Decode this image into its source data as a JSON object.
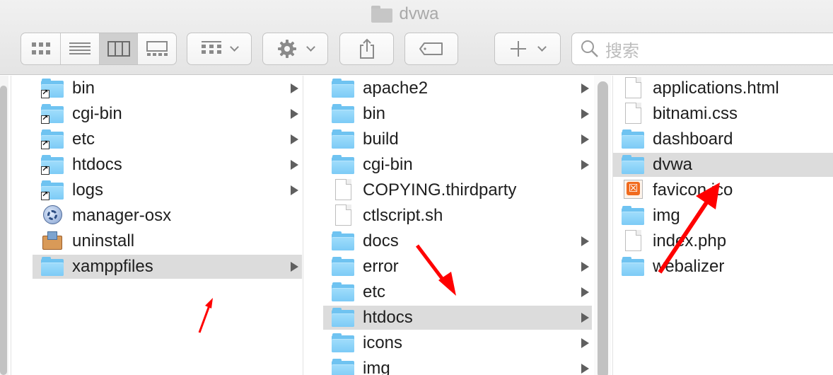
{
  "window": {
    "title": "dvwa"
  },
  "toolbar": {
    "search_placeholder": "搜索"
  },
  "columns": [
    {
      "items": [
        {
          "label": "bin",
          "icon": "folder-alias-icon",
          "has_children": true,
          "selected": false
        },
        {
          "label": "cgi-bin",
          "icon": "folder-alias-icon",
          "has_children": true,
          "selected": false
        },
        {
          "label": "etc",
          "icon": "folder-alias-icon",
          "has_children": true,
          "selected": false
        },
        {
          "label": "htdocs",
          "icon": "folder-alias-icon",
          "has_children": true,
          "selected": false
        },
        {
          "label": "logs",
          "icon": "folder-alias-icon",
          "has_children": true,
          "selected": false
        },
        {
          "label": "manager-osx",
          "icon": "manager-app-icon",
          "has_children": false,
          "selected": false
        },
        {
          "label": "uninstall",
          "icon": "uninstall-app-icon",
          "has_children": false,
          "selected": false
        },
        {
          "label": "xamppfiles",
          "icon": "folder-icon",
          "has_children": true,
          "selected": true
        }
      ]
    },
    {
      "items": [
        {
          "label": "apache2",
          "icon": "folder-icon",
          "has_children": true,
          "selected": false
        },
        {
          "label": "bin",
          "icon": "folder-icon",
          "has_children": true,
          "selected": false
        },
        {
          "label": "build",
          "icon": "folder-icon",
          "has_children": true,
          "selected": false
        },
        {
          "label": "cgi-bin",
          "icon": "folder-icon",
          "has_children": true,
          "selected": false
        },
        {
          "label": "COPYING.thirdparty",
          "icon": "document-icon",
          "has_children": false,
          "selected": false
        },
        {
          "label": "ctlscript.sh",
          "icon": "document-icon",
          "has_children": false,
          "selected": false
        },
        {
          "label": "docs",
          "icon": "folder-icon",
          "has_children": true,
          "selected": false
        },
        {
          "label": "error",
          "icon": "folder-icon",
          "has_children": true,
          "selected": false
        },
        {
          "label": "etc",
          "icon": "folder-icon",
          "has_children": true,
          "selected": false
        },
        {
          "label": "htdocs",
          "icon": "folder-icon",
          "has_children": true,
          "selected": true
        },
        {
          "label": "icons",
          "icon": "folder-icon",
          "has_children": true,
          "selected": false
        },
        {
          "label": "img",
          "icon": "folder-icon",
          "has_children": true,
          "selected": false
        }
      ]
    },
    {
      "items": [
        {
          "label": "applications.html",
          "icon": "document-icon",
          "has_children": false,
          "selected": false
        },
        {
          "label": "bitnami.css",
          "icon": "document-icon",
          "has_children": false,
          "selected": false
        },
        {
          "label": "dashboard",
          "icon": "folder-icon",
          "has_children": false,
          "selected": false
        },
        {
          "label": "dvwa",
          "icon": "folder-icon",
          "has_children": false,
          "selected": true
        },
        {
          "label": "favicon.ico",
          "icon": "xampp-favicon-icon",
          "has_children": false,
          "selected": false
        },
        {
          "label": "img",
          "icon": "folder-icon",
          "has_children": false,
          "selected": false
        },
        {
          "label": "index.php",
          "icon": "document-icon",
          "has_children": false,
          "selected": false
        },
        {
          "label": "webalizer",
          "icon": "folder-icon",
          "has_children": false,
          "selected": false
        }
      ]
    }
  ],
  "colors": {
    "annotation_arrow": "#ff0000",
    "folder_blue": "#7ccbf6",
    "selection_gray": "#dcdcdc"
  }
}
